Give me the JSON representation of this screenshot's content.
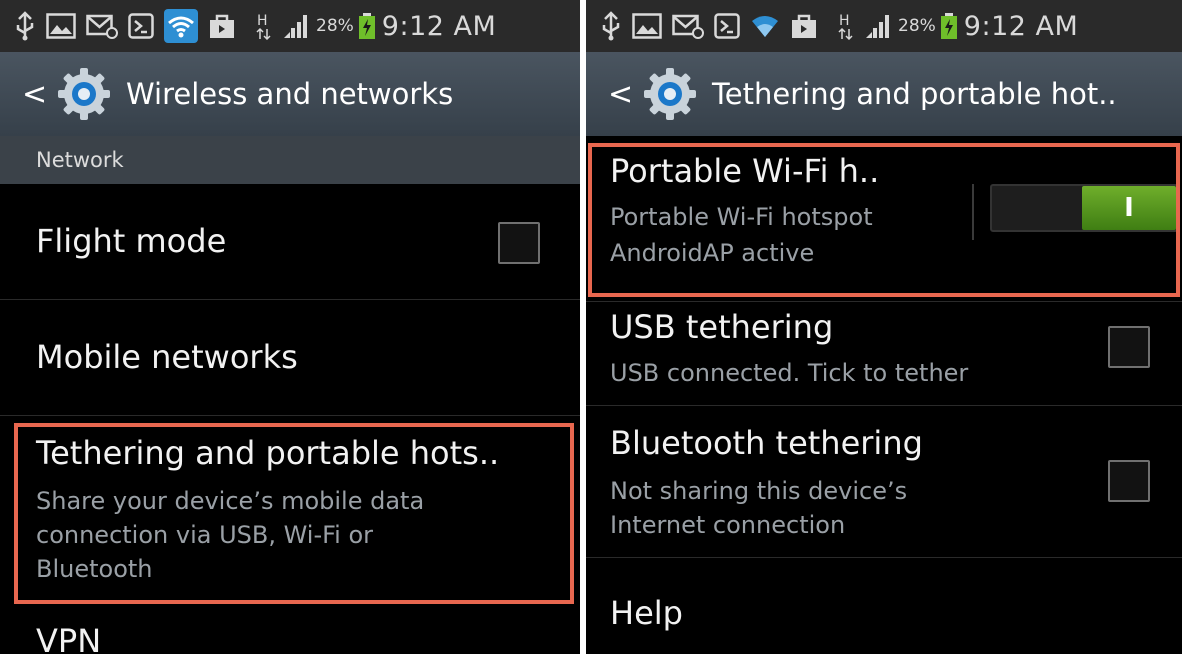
{
  "left": {
    "status": {
      "battery": "28%",
      "time": "9:12 AM"
    },
    "header": {
      "title": "Wireless and networks"
    },
    "section": "Network",
    "items": [
      {
        "title": "Flight mode",
        "checked": false
      },
      {
        "title": "Mobile networks"
      },
      {
        "title": "Tethering and portable hots..",
        "subtitle_lines": [
          "Share your device’s mobile data",
          "connection via USB, Wi-Fi or",
          "Bluetooth"
        ]
      },
      {
        "title": "VPN"
      }
    ]
  },
  "right": {
    "status": {
      "battery": "28%",
      "time": "9:12 AM"
    },
    "header": {
      "title": "Tethering and portable hot.."
    },
    "hotspot": {
      "title": "Portable Wi-Fi h..",
      "subtitle_lines": [
        "Portable Wi-Fi hotspot",
        "AndroidAP active"
      ],
      "toggle_on": true,
      "toggle_on_label": "I"
    },
    "usb": {
      "title": "USB tethering",
      "subtitle": "USB connected. Tick to tether",
      "checked": false
    },
    "bluetooth": {
      "title": "Bluetooth tethering",
      "subtitle_lines": [
        "Not sharing this device’s",
        "Internet connection"
      ],
      "checked": false
    },
    "help": {
      "title": "Help"
    }
  },
  "colors": {
    "highlight": "#e8674f",
    "wifi_active": "#2e8fd3",
    "toggle_on": "#5c9c22",
    "actionbar": "#3f4953"
  },
  "icons": [
    "usb-icon",
    "gallery-icon",
    "email-icon",
    "terminal-icon",
    "wifi-icon",
    "bag-icon",
    "hspa-icon",
    "signal-icon",
    "battery-charging-icon",
    "back-chevron-icon",
    "settings-gear-icon"
  ]
}
